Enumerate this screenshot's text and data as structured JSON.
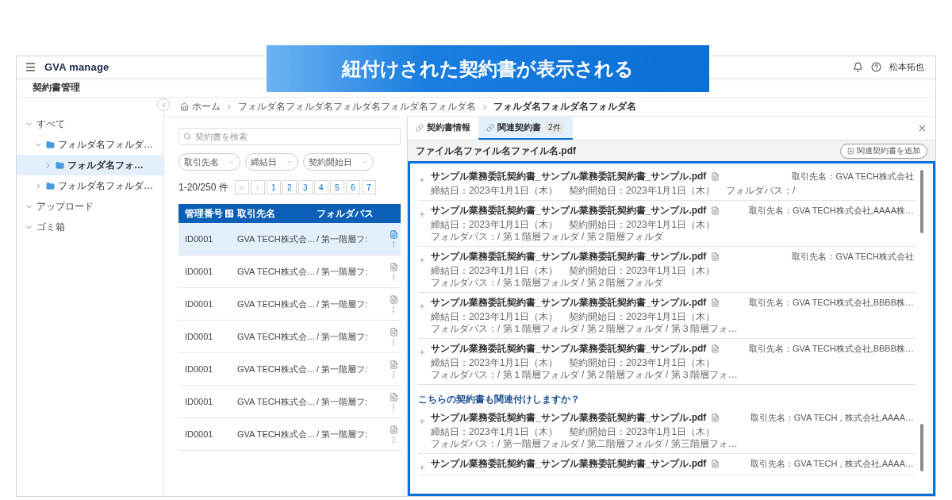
{
  "banner": {
    "text": "紐付けされた契約書が表示される"
  },
  "header": {
    "logo": "GVA manage",
    "user": "松本拓也"
  },
  "page_title": "契約書管理",
  "sidebar": {
    "items": [
      {
        "label": "すべて",
        "kind": "section",
        "expanded": true,
        "selected": false,
        "children": [
          {
            "label": "フォルダ名フォルダ…",
            "kind": "folder",
            "expanded": true,
            "selected": false,
            "children": [
              {
                "label": "フォルダ名フォ…",
                "kind": "folder",
                "expanded": false,
                "selected": true
              }
            ]
          },
          {
            "label": "フォルダ名フォルダ…",
            "kind": "folder",
            "expanded": false,
            "selected": false
          }
        ]
      },
      {
        "label": "アップロード",
        "kind": "section",
        "expanded": true,
        "selected": false
      },
      {
        "label": "ゴミ箱",
        "kind": "section",
        "expanded": true,
        "selected": false
      }
    ]
  },
  "breadcrumb": [
    "ホーム",
    "フォルダ名フォルダ名フォルダ名フォルダ名フォルダ名",
    "フォルダ名フォルダ名フォルダ名"
  ],
  "list": {
    "search": {
      "placeholder": "契約書を検索"
    },
    "filters": [
      "取引先名",
      "締結日",
      "契約開始日"
    ],
    "count": "1-20/250 件",
    "pages": [
      "1",
      "2",
      "3",
      "4",
      "5",
      "6",
      "7"
    ],
    "columns": [
      "管理番号",
      "取引先名",
      "フォルダパス"
    ],
    "rows": [
      {
        "cells": [
          "ID0001",
          "GVA TECH株式会…",
          "/ 第一階層フ:"
        ],
        "selected": true
      },
      {
        "cells": [
          "ID0001",
          "GVA TECH株式会…",
          "/ 第一階層フ:"
        ],
        "selected": false
      },
      {
        "cells": [
          "ID0001",
          "GVA TECH株式会…",
          "/ 第一階層フ:"
        ],
        "selected": false
      },
      {
        "cells": [
          "ID0001",
          "GVA TECH株式会…",
          "/ 第一階層フ:"
        ],
        "selected": false
      },
      {
        "cells": [
          "ID0001",
          "GVA TECH株式会…",
          "/ 第一階層フ:"
        ],
        "selected": false
      },
      {
        "cells": [
          "ID0001",
          "GVA TECH株式会…",
          "/ 第一階層フ:"
        ],
        "selected": false
      },
      {
        "cells": [
          "ID0001",
          "GVA TECH株式会…",
          "/ 第一階層フ:"
        ],
        "selected": false
      }
    ]
  },
  "detail": {
    "tabs": [
      {
        "label": "契約書情報",
        "selected": false
      },
      {
        "label": "関連契約書",
        "badge": "2件",
        "selected": true
      }
    ],
    "file_name": "ファイル名ファイル名ファイル名.pdf",
    "add_button": "関連契約書を追加",
    "related": [
      {
        "title": "サンプル業務委託契約書_サンプル業務委託契約書_サンプル.pdf",
        "party": "取引先名：GVA TECH株式会社",
        "meta": [
          "締結日：2023年1月1日（木）",
          "契約開始日：2023年1月1日（木）",
          "フォルダパス：/"
        ]
      },
      {
        "title": "サンプル業務委託契約書_サンプル業務委託契約書_サンプル.pdf",
        "party": "取引先名：GVA TECH株式会社,AAAA株…",
        "meta": [
          "締結日：2023年1月1日（木）",
          "契約開始日：2023年1月1日（木）",
          "フォルダパス：/ 第１階層フォルダ / 第２階層フォルダ"
        ]
      },
      {
        "title": "サンプル業務委託契約書_サンプル業務委託契約書_サンプル.pdf",
        "party": "取引先名：GVA TECH株式会社",
        "meta": [
          "締結日：2023年1月1日（木）",
          "契約開始日：2023年1月1日（木）",
          "フォルダパス：/ 第１階層フォルダ / 第２階層フォルダ"
        ]
      },
      {
        "title": "サンプル業務委託契約書_サンプル業務委託契約書_サンプル.pdf",
        "party": "取引先名：GVA TECH株式会社,BBBB株…",
        "meta": [
          "締結日：2023年1月1日（木）",
          "契約開始日：2023年1月1日（木）",
          "フォルダパス：/ 第１階層フォルダ / 第２階層フォルダ / 第３階層フォ…"
        ]
      },
      {
        "title": "サンプル業務委託契約書_サンプル業務委託契約書_サンプル.pdf",
        "party": "取引先名：GVA TECH株式会社,BBBB株…",
        "meta": [
          "締結日：2023年1月1日（木）",
          "契約開始日：2023年1月1日（木）",
          "フォルダパス：/ 第１階層フォルダ / 第２階層フォルダ / 第３階層フォ…"
        ]
      }
    ],
    "suggest_heading": "こちらの契約書も関連付けしますか？",
    "suggestions": [
      {
        "title": "サンプル業務委託契約書_サンプル業務委託契約書_サンプル.pdf",
        "party": "取引先名：GVA TECH , 株式会社,AAAA…",
        "meta": [
          "締結日：2023年1月1日（木）",
          "契約開始日：2023年1月1日（木）",
          "フォルダパス：/ 第一階層フォルダ / 第二階層フォルダ / 第三階層フォ…"
        ]
      },
      {
        "title": "サンプル業務委託契約書_サンプル業務委託契約書_サンプル.pdf",
        "party": "取引先名：GVA TECH , 株式会社,AAAA…"
      }
    ]
  }
}
